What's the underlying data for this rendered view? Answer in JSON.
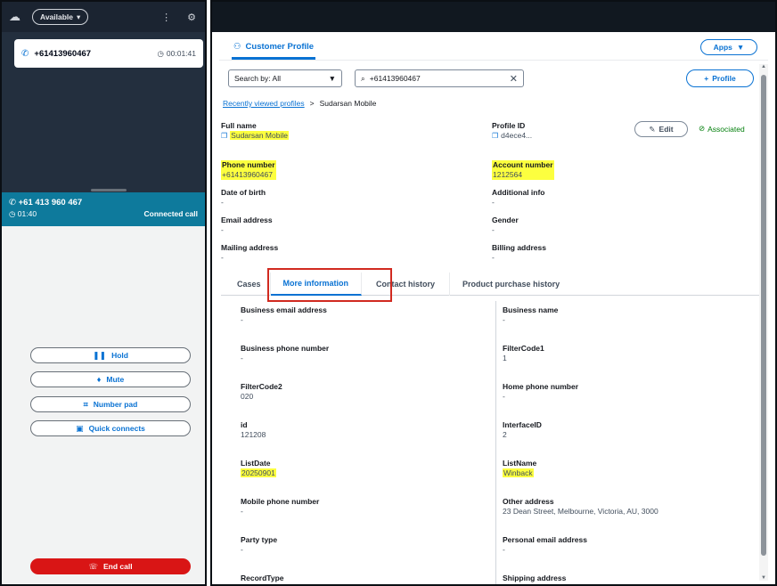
{
  "ccp": {
    "status": "Available",
    "active_call": {
      "number": "+61413960467",
      "timer": "00:01:41"
    },
    "connected": {
      "number": "+61 413 960 467",
      "timer": "01:40",
      "status": "Connected call"
    },
    "buttons": {
      "hold": "Hold",
      "mute": "Mute",
      "number_pad": "Number pad",
      "quick_connects": "Quick connects",
      "end_call": "End call"
    }
  },
  "profile": {
    "tab_label": "Customer Profile",
    "apps_label": "Apps",
    "search_by": "Search by: All",
    "search_value": "+61413960467",
    "add_profile_label": "Profile",
    "breadcrumb": {
      "link": "Recently viewed profiles",
      "current": "Sudarsan Mobile"
    },
    "edit_label": "Edit",
    "associated_label": "Associated",
    "fields": {
      "full_name": {
        "label": "Full name",
        "value": "Sudarsan Mobile"
      },
      "profile_id": {
        "label": "Profile ID",
        "value": "d4ece4..."
      },
      "phone_number": {
        "label": "Phone number",
        "value": "+61413960467"
      },
      "account_number": {
        "label": "Account number",
        "value": "1212564"
      },
      "date_of_birth": {
        "label": "Date of birth",
        "value": "-"
      },
      "additional_info": {
        "label": "Additional info",
        "value": "-"
      },
      "email_address": {
        "label": "Email address",
        "value": "-"
      },
      "gender": {
        "label": "Gender",
        "value": "-"
      },
      "mailing_address": {
        "label": "Mailing address",
        "value": "-"
      },
      "billing_address": {
        "label": "Billing address",
        "value": "-"
      }
    },
    "tabs": [
      "Cases",
      "More information",
      "Contact history",
      "Product purchase history"
    ],
    "more_info_left": [
      {
        "label": "Business email address",
        "value": "-"
      },
      {
        "label": "Business phone number",
        "value": "-"
      },
      {
        "label": "FilterCode2",
        "value": "020"
      },
      {
        "label": "id",
        "value": "121208"
      },
      {
        "label": "ListDate",
        "value": "20250901"
      },
      {
        "label": "Mobile phone number",
        "value": "-"
      },
      {
        "label": "Party type",
        "value": "-"
      },
      {
        "label": "RecordType",
        "value": ""
      }
    ],
    "more_info_right": [
      {
        "label": "Business name",
        "value": "-"
      },
      {
        "label": "FilterCode1",
        "value": "1"
      },
      {
        "label": "Home phone number",
        "value": "-"
      },
      {
        "label": "InterfaceID",
        "value": "2"
      },
      {
        "label": "ListName",
        "value": "Winback"
      },
      {
        "label": "Other address",
        "value": "23 Dean Street, Melbourne, Victoria, AU, 3000"
      },
      {
        "label": "Personal email address",
        "value": "-"
      },
      {
        "label": "Shipping address",
        "value": ""
      }
    ]
  },
  "colors": {
    "accent": "#0972d3",
    "connected_bar": "#0e7a9c",
    "end_call": "#d91515",
    "highlight": "#fcff3f",
    "annotation_box": "#d12a20"
  },
  "icons": [
    "cloud-icon",
    "chevron-down-icon",
    "settings-icon",
    "phone-icon",
    "clock-icon",
    "pause-icon",
    "microphone-icon",
    "keypad-icon",
    "quick-connect-icon",
    "hangup-icon",
    "user-icon",
    "search-icon",
    "clear-icon",
    "plus-icon",
    "copy-icon",
    "edit-icon",
    "check-circle-icon"
  ]
}
